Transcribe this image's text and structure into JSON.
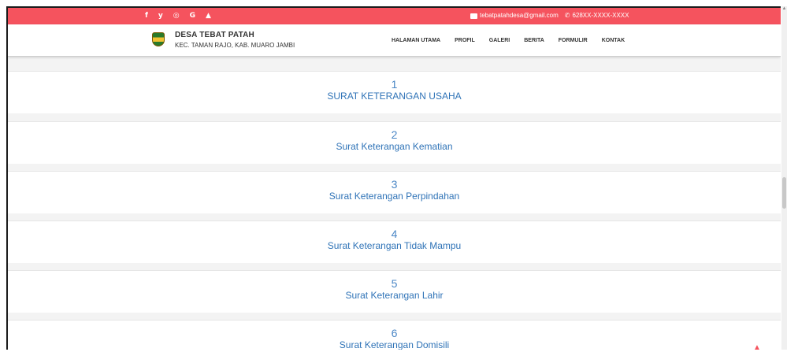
{
  "topbar": {
    "social_icons": [
      {
        "name": "facebook-icon",
        "glyph": "f"
      },
      {
        "name": "twitter-icon",
        "glyph": "y"
      },
      {
        "name": "instagram-icon",
        "glyph": "◎"
      },
      {
        "name": "google-icon",
        "glyph": "G"
      },
      {
        "name": "android-icon",
        "glyph": "▲"
      }
    ],
    "email": "tebatpatahdesa@gmail.com",
    "phone": "628XX-XXXX-XXXX",
    "color": "#f5535e"
  },
  "header": {
    "title": "DESA TEBAT PATAH",
    "subtitle": "KEC. TAMAN RAJO, KAB. MUARO JAMBI"
  },
  "menu": {
    "items": [
      {
        "label": "HALAMAN UTAMA"
      },
      {
        "label": "PROFIL"
      },
      {
        "label": "GALERI"
      },
      {
        "label": "BERITA"
      },
      {
        "label": "FORMULIR"
      },
      {
        "label": "KONTAK"
      }
    ]
  },
  "letters": [
    {
      "number": "1",
      "title": "SURAT KETERANGAN USAHA"
    },
    {
      "number": "2",
      "title": "Surat Keterangan Kematian"
    },
    {
      "number": "3",
      "title": "Surat Keterangan Perpindahan"
    },
    {
      "number": "4",
      "title": "Surat Keterangan Tidak Mampu"
    },
    {
      "number": "5",
      "title": "Surat Keterangan Lahir"
    },
    {
      "number": "6",
      "title": "Surat Keterangan Domisili"
    }
  ]
}
